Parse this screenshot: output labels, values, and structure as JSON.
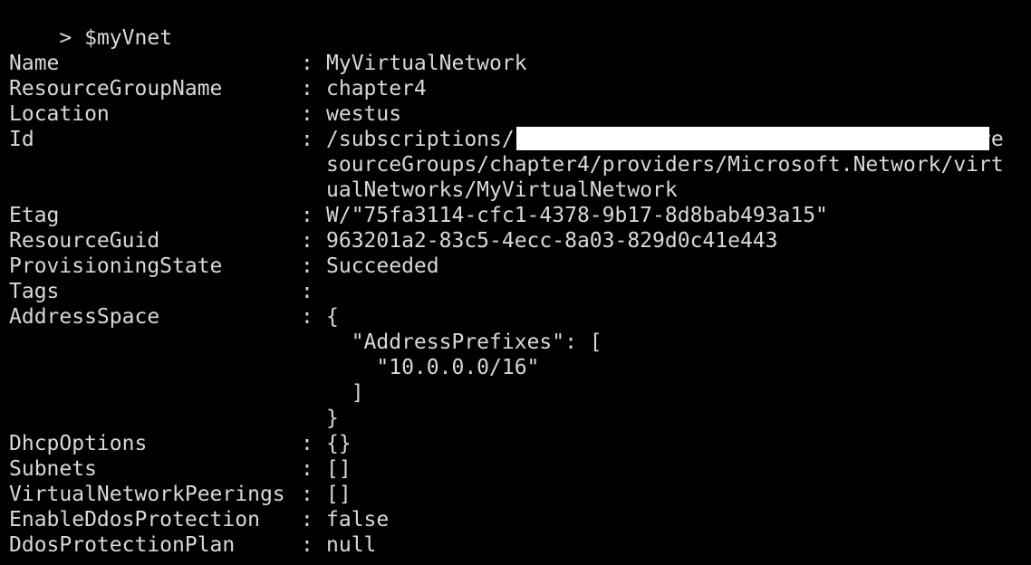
{
  "prompt": {
    "symbol": ">",
    "command": "$myVnet"
  },
  "separator": ":",
  "properties": [
    {
      "key": "Name",
      "lines": [
        "MyVirtualNetwork"
      ]
    },
    {
      "key": "ResourceGroupName",
      "lines": [
        "chapter4"
      ]
    },
    {
      "key": "Location",
      "lines": [
        "westus"
      ]
    },
    {
      "key": "Id",
      "lines": [
        "/subscriptions/                                    /re",
        "sourceGroups/chapter4/providers/Microsoft.Network/virt",
        "ualNetworks/MyVirtualNetwork"
      ]
    },
    {
      "key": "Etag",
      "lines": [
        "W/\"75fa3114-cfc1-4378-9b17-8d8bab493a15\""
      ]
    },
    {
      "key": "ResourceGuid",
      "lines": [
        "963201a2-83c5-4ecc-8a03-829d0c41e443"
      ]
    },
    {
      "key": "ProvisioningState",
      "lines": [
        "Succeeded"
      ]
    },
    {
      "key": "Tags",
      "lines": [
        ""
      ]
    },
    {
      "key": "AddressSpace",
      "lines": [
        "{",
        "  \"AddressPrefixes\": [",
        "    \"10.0.0.0/16\"",
        "  ]",
        "}"
      ]
    },
    {
      "key": "DhcpOptions",
      "lines": [
        "{}"
      ]
    },
    {
      "key": "Subnets",
      "lines": [
        "[]"
      ]
    },
    {
      "key": "VirtualNetworkPeerings",
      "lines": [
        "[]"
      ]
    },
    {
      "key": "EnableDdosProtection",
      "lines": [
        "false"
      ]
    },
    {
      "key": "DdosProtectionPlan",
      "lines": [
        "null"
      ]
    }
  ],
  "colors": {
    "background": "#000000",
    "text": "#d8d8d8",
    "redaction": "#ffffff"
  }
}
